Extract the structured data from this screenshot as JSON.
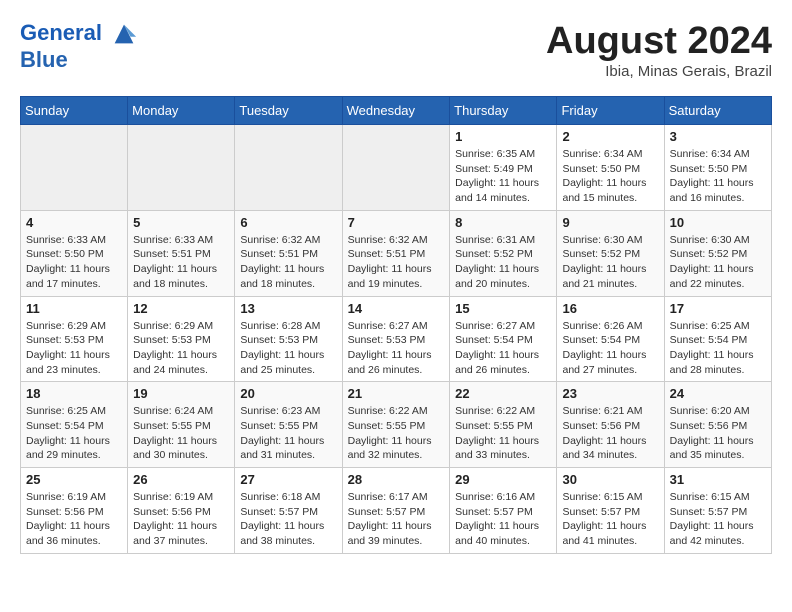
{
  "header": {
    "logo_line1": "General",
    "logo_line2": "Blue",
    "month_year": "August 2024",
    "location": "Ibia, Minas Gerais, Brazil"
  },
  "weekdays": [
    "Sunday",
    "Monday",
    "Tuesday",
    "Wednesday",
    "Thursday",
    "Friday",
    "Saturday"
  ],
  "weeks": [
    [
      {
        "day": "",
        "empty": true
      },
      {
        "day": "",
        "empty": true
      },
      {
        "day": "",
        "empty": true
      },
      {
        "day": "",
        "empty": true
      },
      {
        "day": "1",
        "sunrise": "6:35 AM",
        "sunset": "5:49 PM",
        "daylight": "11 hours and 14 minutes."
      },
      {
        "day": "2",
        "sunrise": "6:34 AM",
        "sunset": "5:50 PM",
        "daylight": "11 hours and 15 minutes."
      },
      {
        "day": "3",
        "sunrise": "6:34 AM",
        "sunset": "5:50 PM",
        "daylight": "11 hours and 16 minutes."
      }
    ],
    [
      {
        "day": "4",
        "sunrise": "6:33 AM",
        "sunset": "5:50 PM",
        "daylight": "11 hours and 17 minutes."
      },
      {
        "day": "5",
        "sunrise": "6:33 AM",
        "sunset": "5:51 PM",
        "daylight": "11 hours and 18 minutes."
      },
      {
        "day": "6",
        "sunrise": "6:32 AM",
        "sunset": "5:51 PM",
        "daylight": "11 hours and 18 minutes."
      },
      {
        "day": "7",
        "sunrise": "6:32 AM",
        "sunset": "5:51 PM",
        "daylight": "11 hours and 19 minutes."
      },
      {
        "day": "8",
        "sunrise": "6:31 AM",
        "sunset": "5:52 PM",
        "daylight": "11 hours and 20 minutes."
      },
      {
        "day": "9",
        "sunrise": "6:30 AM",
        "sunset": "5:52 PM",
        "daylight": "11 hours and 21 minutes."
      },
      {
        "day": "10",
        "sunrise": "6:30 AM",
        "sunset": "5:52 PM",
        "daylight": "11 hours and 22 minutes."
      }
    ],
    [
      {
        "day": "11",
        "sunrise": "6:29 AM",
        "sunset": "5:53 PM",
        "daylight": "11 hours and 23 minutes."
      },
      {
        "day": "12",
        "sunrise": "6:29 AM",
        "sunset": "5:53 PM",
        "daylight": "11 hours and 24 minutes."
      },
      {
        "day": "13",
        "sunrise": "6:28 AM",
        "sunset": "5:53 PM",
        "daylight": "11 hours and 25 minutes."
      },
      {
        "day": "14",
        "sunrise": "6:27 AM",
        "sunset": "5:53 PM",
        "daylight": "11 hours and 26 minutes."
      },
      {
        "day": "15",
        "sunrise": "6:27 AM",
        "sunset": "5:54 PM",
        "daylight": "11 hours and 26 minutes."
      },
      {
        "day": "16",
        "sunrise": "6:26 AM",
        "sunset": "5:54 PM",
        "daylight": "11 hours and 27 minutes."
      },
      {
        "day": "17",
        "sunrise": "6:25 AM",
        "sunset": "5:54 PM",
        "daylight": "11 hours and 28 minutes."
      }
    ],
    [
      {
        "day": "18",
        "sunrise": "6:25 AM",
        "sunset": "5:54 PM",
        "daylight": "11 hours and 29 minutes."
      },
      {
        "day": "19",
        "sunrise": "6:24 AM",
        "sunset": "5:55 PM",
        "daylight": "11 hours and 30 minutes."
      },
      {
        "day": "20",
        "sunrise": "6:23 AM",
        "sunset": "5:55 PM",
        "daylight": "11 hours and 31 minutes."
      },
      {
        "day": "21",
        "sunrise": "6:22 AM",
        "sunset": "5:55 PM",
        "daylight": "11 hours and 32 minutes."
      },
      {
        "day": "22",
        "sunrise": "6:22 AM",
        "sunset": "5:55 PM",
        "daylight": "11 hours and 33 minutes."
      },
      {
        "day": "23",
        "sunrise": "6:21 AM",
        "sunset": "5:56 PM",
        "daylight": "11 hours and 34 minutes."
      },
      {
        "day": "24",
        "sunrise": "6:20 AM",
        "sunset": "5:56 PM",
        "daylight": "11 hours and 35 minutes."
      }
    ],
    [
      {
        "day": "25",
        "sunrise": "6:19 AM",
        "sunset": "5:56 PM",
        "daylight": "11 hours and 36 minutes."
      },
      {
        "day": "26",
        "sunrise": "6:19 AM",
        "sunset": "5:56 PM",
        "daylight": "11 hours and 37 minutes."
      },
      {
        "day": "27",
        "sunrise": "6:18 AM",
        "sunset": "5:57 PM",
        "daylight": "11 hours and 38 minutes."
      },
      {
        "day": "28",
        "sunrise": "6:17 AM",
        "sunset": "5:57 PM",
        "daylight": "11 hours and 39 minutes."
      },
      {
        "day": "29",
        "sunrise": "6:16 AM",
        "sunset": "5:57 PM",
        "daylight": "11 hours and 40 minutes."
      },
      {
        "day": "30",
        "sunrise": "6:15 AM",
        "sunset": "5:57 PM",
        "daylight": "11 hours and 41 minutes."
      },
      {
        "day": "31",
        "sunrise": "6:15 AM",
        "sunset": "5:57 PM",
        "daylight": "11 hours and 42 minutes."
      }
    ]
  ]
}
